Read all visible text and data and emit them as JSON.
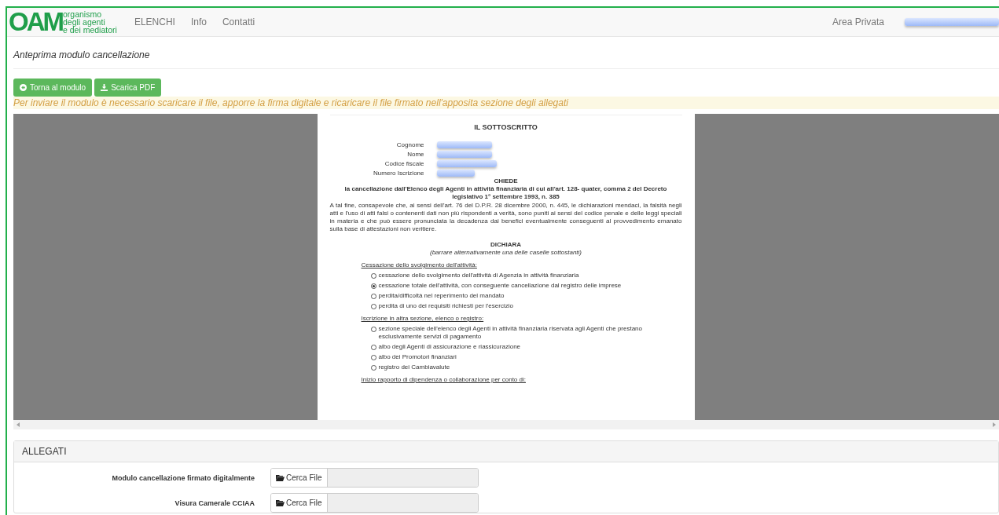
{
  "navbar": {
    "logo": {
      "mark": "OAM",
      "lines": [
        "organismo",
        "degli agenti",
        "e dei mediatori"
      ]
    },
    "links": [
      "ELENCHI",
      "Info",
      "Contatti"
    ],
    "area_privata": "Area Privata"
  },
  "page_title": "Anteprima modulo cancellazione",
  "buttons": [
    {
      "label": "Torna al modulo",
      "kind": "back"
    },
    {
      "label": "Scarica PDF",
      "kind": "download"
    }
  ],
  "notice": "Per inviare il modulo è necessario scaricare il file, apporre la firma digitale e ricaricare il file firmato nell'apposita sezione degli allegati",
  "document": {
    "heading": "IL SOTTOSCRITTO",
    "fields": [
      "Cognome",
      "Nome",
      "Codice fiscale",
      "Numero Iscrizione"
    ],
    "request_title": "CHIEDE",
    "request_text": "la cancellazione dall'Elenco degli Agenti in attività finanziaria di cui all'art. 128- quater, comma 2 del Decreto legislativo 1° settembre 1993, n. 385",
    "body": "A tal fine, consapevole che, ai sensi dell'art. 76 del D.P.R. 28 dicembre 2000, n. 445, le dichiarazioni mendaci, la falsità negli atti e l'uso di atti falsi o contenenti dati non più rispondenti a verità, sono puniti ai sensi del codice penale e delle leggi speciali in materia e che può essere pronunciata la decadenza dai benefici eventualmente conseguenti al provvedimento emanato sulla base di attestazioni non veritiere.",
    "declare_title": "DICHIARA",
    "declare_hint": "(barrare alternativamente una delle caselle sottostanti)",
    "sections": [
      {
        "title": "Cessazione dello svolgimento dell'attività:",
        "options": [
          {
            "label": "cessazione dello svolgimento dell'attività di Agenzia in attività finanziaria",
            "selected": false
          },
          {
            "label": "cessazione totale dell'attività, con conseguente cancellazione dal registro delle imprese",
            "selected": true
          },
          {
            "label": "perdita/difficoltà nel reperimento del mandato",
            "selected": false
          },
          {
            "label": "perdita di uno dei requisiti richiesti per l'esercizio",
            "selected": false
          }
        ]
      },
      {
        "title": "Iscrizione in altra sezione, elenco o registro:",
        "options": [
          {
            "label": "sezione speciale dell'elenco degli Agenti in attività finanziaria riservata agli Agenti che prestano esclusivamente servizi di pagamento",
            "selected": false
          },
          {
            "label": "albo degli Agenti di assicurazione e riassicurazione",
            "selected": false
          },
          {
            "label": "albo dei Promotori finanziari",
            "selected": false
          },
          {
            "label": "registro dei Cambiavalute",
            "selected": false
          }
        ]
      },
      {
        "title": "Inizio rapporto di dipendenza o collaborazione per conto di:"
      }
    ]
  },
  "attachments": {
    "title": "ALLEGATI",
    "rows": [
      {
        "label": "Modulo cancellazione firmato digitalmente",
        "button": "Cerca File"
      },
      {
        "label": "Visura Camerale CCIAA",
        "button": "Cerca File"
      }
    ]
  }
}
